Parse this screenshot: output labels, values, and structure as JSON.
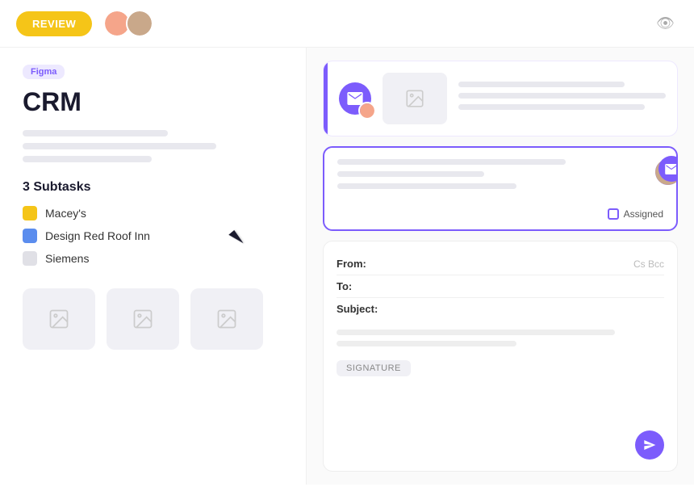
{
  "topbar": {
    "review_label": "REVIEW",
    "eye_icon": "👁"
  },
  "left": {
    "badge": "Figma",
    "title": "CRM",
    "desc_lines": [
      180,
      240,
      160
    ],
    "subtasks_title": "3 Subtasks",
    "subtasks": [
      {
        "name": "Macey's",
        "color": "yellow"
      },
      {
        "name": "Design Red Roof Inn",
        "color": "blue"
      },
      {
        "name": "Siemens",
        "color": "gray"
      }
    ],
    "thumbnails": [
      "🖼",
      "🖼",
      "🖼"
    ]
  },
  "right": {
    "card1": {
      "icon": "✉",
      "lines": [
        120,
        180,
        160
      ]
    },
    "card2": {
      "assigned_label": "Assigned",
      "lines": [
        160,
        100,
        120
      ]
    },
    "compose": {
      "from_label": "From:",
      "to_label": "To:",
      "subject_label": "Subject:",
      "cc_label": "Cs Bcc",
      "body_lines": [
        180,
        120
      ],
      "signature_btn": "SIGNATURE",
      "send_icon": "✈"
    }
  },
  "colors": {
    "accent": "#7c5cfc",
    "yellow": "#f5c518",
    "blue": "#5b8dee"
  }
}
